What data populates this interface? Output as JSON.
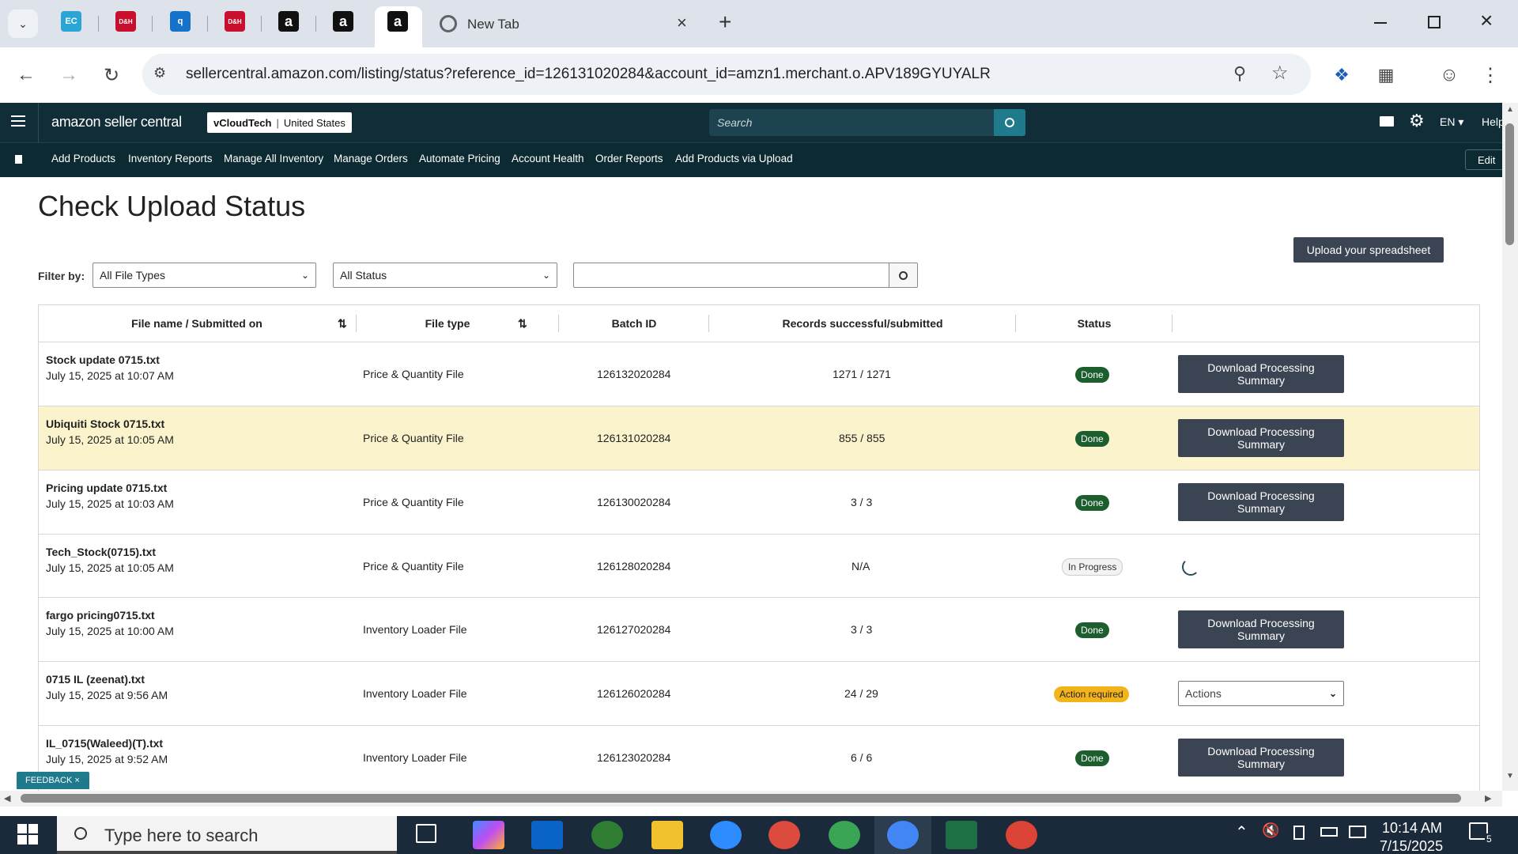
{
  "browser": {
    "tabs": [
      {
        "icon": "ec-icon",
        "label": "EC"
      },
      {
        "icon": "dh-icon",
        "label": "D&H"
      },
      {
        "icon": "blue-q-icon",
        "label": ""
      },
      {
        "icon": "dh-icon",
        "label": "D&H"
      },
      {
        "icon": "amazon-icon",
        "label": "a"
      },
      {
        "icon": "amazon-icon",
        "label": "a"
      },
      {
        "icon": "amazon-icon",
        "label": "a"
      }
    ],
    "new_tab_label": "New Tab",
    "url": "sellercentral.amazon.com/listing/status?reference_id=126131020284&account_id=amzn1.merchant.o.APV189GYUYALR"
  },
  "amazon": {
    "logo": "amazon seller central",
    "store_name": "vCloudTech",
    "store_region": "United States",
    "search_placeholder": "Search",
    "lang": "EN",
    "help": "Help",
    "nav": [
      "Add Products",
      "Inventory Reports",
      "Manage All Inventory",
      "Manage Orders",
      "Automate Pricing",
      "Account Health",
      "Order Reports",
      "Add Products via Upload"
    ],
    "edit": "Edit"
  },
  "page": {
    "title": "Check Upload Status",
    "upload_button": "Upload your spreadsheet",
    "filter_label": "Filter by:",
    "file_type_filter": "All File Types",
    "status_filter": "All Status",
    "search_value": ""
  },
  "table": {
    "headers": [
      "File name / Submitted on",
      "File type",
      "Batch ID",
      "Records successful/submitted",
      "Status"
    ],
    "rows": [
      {
        "name": "Stock update 0715.txt",
        "date": "July 15, 2025 at 10:07 AM",
        "type": "Price & Quantity File",
        "batch": "126132020284",
        "records": "1271 / 1271",
        "status": "Done",
        "action": "Download Processing Summary"
      },
      {
        "name": "Ubiquiti Stock 0715.txt",
        "date": "July 15, 2025 at 10:05 AM",
        "type": "Price & Quantity File",
        "batch": "126131020284",
        "records": "855 / 855",
        "status": "Done",
        "action": "Download Processing Summary"
      },
      {
        "name": "Pricing update 0715.txt",
        "date": "July 15, 2025 at 10:03 AM",
        "type": "Price & Quantity File",
        "batch": "126130020284",
        "records": "3 / 3",
        "status": "Done",
        "action": "Download Processing Summary"
      },
      {
        "name": "Tech_Stock(0715).txt",
        "date": "July 15, 2025 at 10:05 AM",
        "type": "Price & Quantity File",
        "batch": "126128020284",
        "records": "N/A",
        "status": "In Progress",
        "action": ""
      },
      {
        "name": "fargo pricing0715.txt",
        "date": "July 15, 2025 at 10:00 AM",
        "type": "Inventory Loader File",
        "batch": "126127020284",
        "records": "3 / 3",
        "status": "Done",
        "action": "Download Processing Summary"
      },
      {
        "name": "0715 IL (zeenat).txt",
        "date": "July 15, 2025 at 9:56 AM",
        "type": "Inventory Loader File",
        "batch": "126126020284",
        "records": "24 / 29",
        "status": "Action required",
        "action": "Actions"
      },
      {
        "name": "IL_0715(Waleed)(T).txt",
        "date": "July 15, 2025 at 9:52 AM",
        "type": "Inventory Loader File",
        "batch": "126123020284",
        "records": "6 / 6",
        "status": "Done",
        "action": "Download Processing Summary"
      }
    ]
  },
  "feedback": "FEEDBACK",
  "taskbar": {
    "search_placeholder": "Type here to search",
    "time": "10:14 AM",
    "date": "7/15/2025",
    "notification_count": "5"
  }
}
